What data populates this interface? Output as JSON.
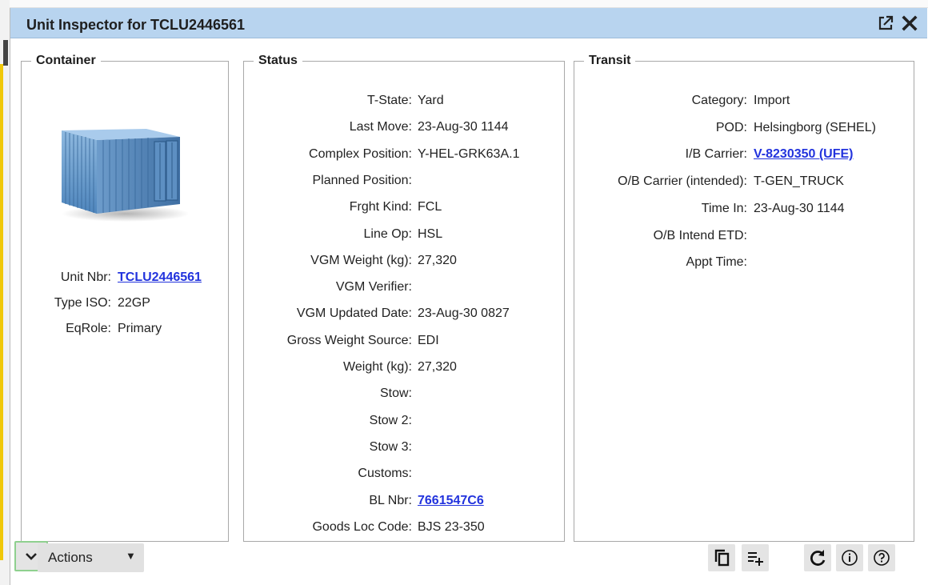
{
  "window": {
    "title": "Unit Inspector for TCLU2446561"
  },
  "icons": {
    "popout": "external-link-icon",
    "close": "close-icon",
    "copy": "copy-icon",
    "add_list": "playlist-add-icon",
    "refresh": "refresh-icon",
    "info": "info-icon",
    "help": "help-icon",
    "collapse": "chevron-down-icon"
  },
  "container": {
    "legend": "Container",
    "fields": [
      {
        "label": "Unit Nbr:",
        "value": "TCLU2446561",
        "link": true
      },
      {
        "label": "Type ISO:",
        "value": "22GP",
        "link": false
      },
      {
        "label": "EqRole:",
        "value": "Primary",
        "link": false
      }
    ]
  },
  "status": {
    "legend": "Status",
    "fields": [
      {
        "label": "T-State:",
        "value": "Yard",
        "link": false
      },
      {
        "label": "Last Move:",
        "value": "23-Aug-30 1144",
        "link": false
      },
      {
        "label": "Complex Position:",
        "value": "Y-HEL-GRK63A.1",
        "link": false
      },
      {
        "label": "Planned Position:",
        "value": "",
        "link": false
      },
      {
        "label": "Frght Kind:",
        "value": "FCL",
        "link": false
      },
      {
        "label": "Line Op:",
        "value": "HSL",
        "link": false
      },
      {
        "label": "VGM Weight (kg):",
        "value": "27,320",
        "link": false
      },
      {
        "label": "VGM Verifier:",
        "value": "",
        "link": false
      },
      {
        "label": "VGM Updated Date:",
        "value": "23-Aug-30 0827",
        "link": false
      },
      {
        "label": "Gross Weight Source:",
        "value": "EDI",
        "link": false
      },
      {
        "label": "Weight (kg):",
        "value": "27,320",
        "link": false
      },
      {
        "label": "Stow:",
        "value": "",
        "link": false
      },
      {
        "label": "Stow 2:",
        "value": "",
        "link": false
      },
      {
        "label": "Stow 3:",
        "value": "",
        "link": false
      },
      {
        "label": "Customs:",
        "value": "",
        "link": false
      },
      {
        "label": "BL Nbr:",
        "value": "7661547C6",
        "link": true
      },
      {
        "label": "Goods Loc Code:",
        "value": "BJS 23-350",
        "link": false
      }
    ]
  },
  "transit": {
    "legend": "Transit",
    "fields": [
      {
        "label": "Category:",
        "value": "Import",
        "link": false
      },
      {
        "label": "POD:",
        "value": "Helsingborg (SEHEL)",
        "link": false
      },
      {
        "label": "I/B Carrier:",
        "value": "V-8230350 (UFE)",
        "link": true
      },
      {
        "label": "O/B Carrier (intended):",
        "value": "T-GEN_TRUCK",
        "link": false
      },
      {
        "label": "Time In:",
        "value": "23-Aug-30 1144",
        "link": false
      },
      {
        "label": "O/B Intend ETD:",
        "value": "",
        "link": false
      },
      {
        "label": "Appt Time:",
        "value": "",
        "link": false
      }
    ]
  },
  "footer": {
    "actions_label": "Actions"
  }
}
